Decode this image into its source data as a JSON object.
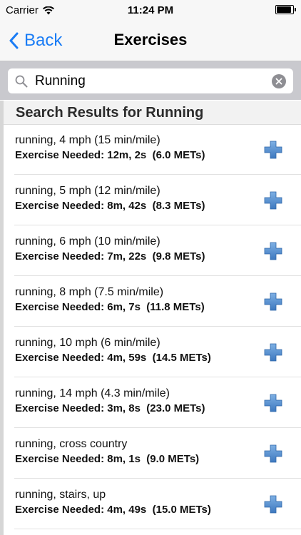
{
  "status_bar": {
    "carrier": "Carrier",
    "time": "11:24 PM"
  },
  "nav": {
    "back_label": "Back",
    "title": "Exercises"
  },
  "search": {
    "value": "Running"
  },
  "section_header": "Search Results for Running",
  "results": [
    {
      "name": "running, 4 mph (15 min/mile)",
      "detail": "Exercise Needed: 12m, 2s  (6.0 METs)"
    },
    {
      "name": "running, 5 mph (12 min/mile)",
      "detail": "Exercise Needed: 8m, 42s  (8.3 METs)"
    },
    {
      "name": "running, 6 mph (10 min/mile)",
      "detail": "Exercise Needed: 7m, 22s  (9.8 METs)"
    },
    {
      "name": "running, 8 mph (7.5 min/mile)",
      "detail": "Exercise Needed: 6m, 7s  (11.8 METs)"
    },
    {
      "name": "running, 10 mph (6 min/mile)",
      "detail": "Exercise Needed: 4m, 59s  (14.5 METs)"
    },
    {
      "name": "running, 14 mph (4.3 min/mile)",
      "detail": "Exercise Needed: 3m, 8s  (23.0 METs)"
    },
    {
      "name": "running, cross country",
      "detail": "Exercise Needed: 8m, 1s  (9.0 METs)"
    },
    {
      "name": "running, stairs, up",
      "detail": "Exercise Needed: 4m, 49s  (15.0 METs)"
    }
  ],
  "colors": {
    "accent": "#1a7cf5",
    "add_icon": "#4a86c8"
  }
}
